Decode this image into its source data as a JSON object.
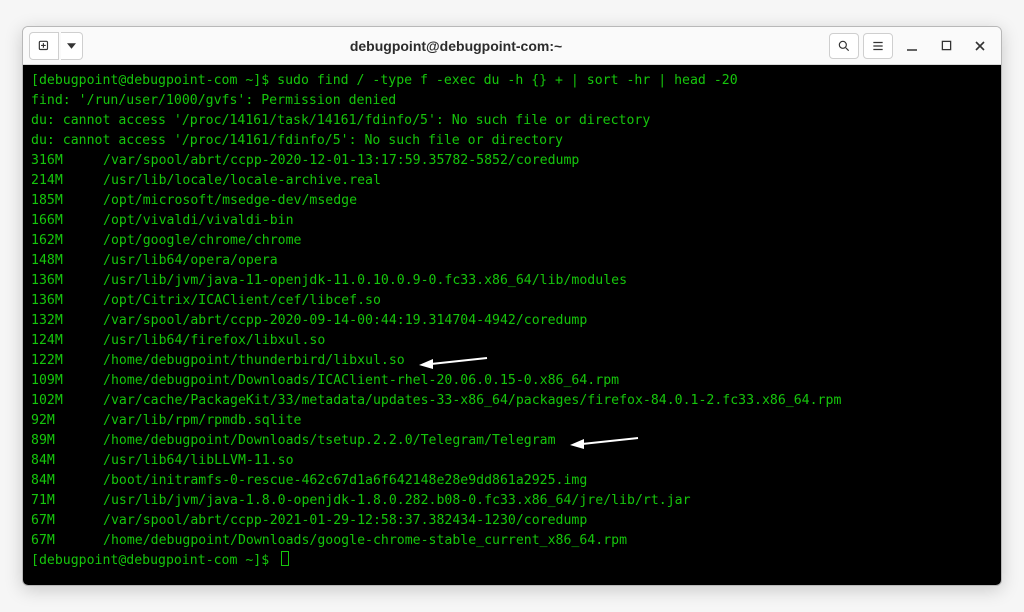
{
  "window": {
    "title": "debugpoint@debugpoint-com:~"
  },
  "terminal": {
    "prompt": "[debugpoint@debugpoint-com ~]$",
    "command": "sudo find / -type f -exec du -h {} + | sort -hr | head -20",
    "errors": [
      "find: '/run/user/1000/gvfs': Permission denied",
      "du: cannot access '/proc/14161/task/14161/fdinfo/5': No such file or directory",
      "du: cannot access '/proc/14161/fdinfo/5': No such file or directory"
    ],
    "rows": [
      {
        "size": "316M",
        "path": "/var/spool/abrt/ccpp-2020-12-01-13:17:59.35782-5852/coredump"
      },
      {
        "size": "214M",
        "path": "/usr/lib/locale/locale-archive.real"
      },
      {
        "size": "185M",
        "path": "/opt/microsoft/msedge-dev/msedge"
      },
      {
        "size": "166M",
        "path": "/opt/vivaldi/vivaldi-bin"
      },
      {
        "size": "162M",
        "path": "/opt/google/chrome/chrome"
      },
      {
        "size": "148M",
        "path": "/usr/lib64/opera/opera"
      },
      {
        "size": "136M",
        "path": "/usr/lib/jvm/java-11-openjdk-11.0.10.0.9-0.fc33.x86_64/lib/modules"
      },
      {
        "size": "136M",
        "path": "/opt/Citrix/ICAClient/cef/libcef.so"
      },
      {
        "size": "132M",
        "path": "/var/spool/abrt/ccpp-2020-09-14-00:44:19.314704-4942/coredump"
      },
      {
        "size": "124M",
        "path": "/usr/lib64/firefox/libxul.so"
      },
      {
        "size": "122M",
        "path": "/home/debugpoint/thunderbird/libxul.so"
      },
      {
        "size": "109M",
        "path": "/home/debugpoint/Downloads/ICAClient-rhel-20.06.0.15-0.x86_64.rpm"
      },
      {
        "size": "102M",
        "path": "/var/cache/PackageKit/33/metadata/updates-33-x86_64/packages/firefox-84.0.1-2.fc33.x86_64.rpm"
      },
      {
        "size": "92M",
        "path": "/var/lib/rpm/rpmdb.sqlite"
      },
      {
        "size": "89M",
        "path": "/home/debugpoint/Downloads/tsetup.2.2.0/Telegram/Telegram"
      },
      {
        "size": "84M",
        "path": "/usr/lib64/libLLVM-11.so"
      },
      {
        "size": "84M",
        "path": "/boot/initramfs-0-rescue-462c67d1a6f642148e28e9dd861a2925.img"
      },
      {
        "size": "71M",
        "path": "/usr/lib/jvm/java-1.8.0-openjdk-1.8.0.282.b08-0.fc33.x86_64/jre/lib/rt.jar"
      },
      {
        "size": "67M",
        "path": "/var/spool/abrt/ccpp-2021-01-29-12:58:37.382434-1230/coredump"
      },
      {
        "size": "67M",
        "path": "/home/debugpoint/Downloads/google-chrome-stable_current_x86_64.rpm"
      }
    ],
    "arrows": [
      10,
      14
    ]
  }
}
